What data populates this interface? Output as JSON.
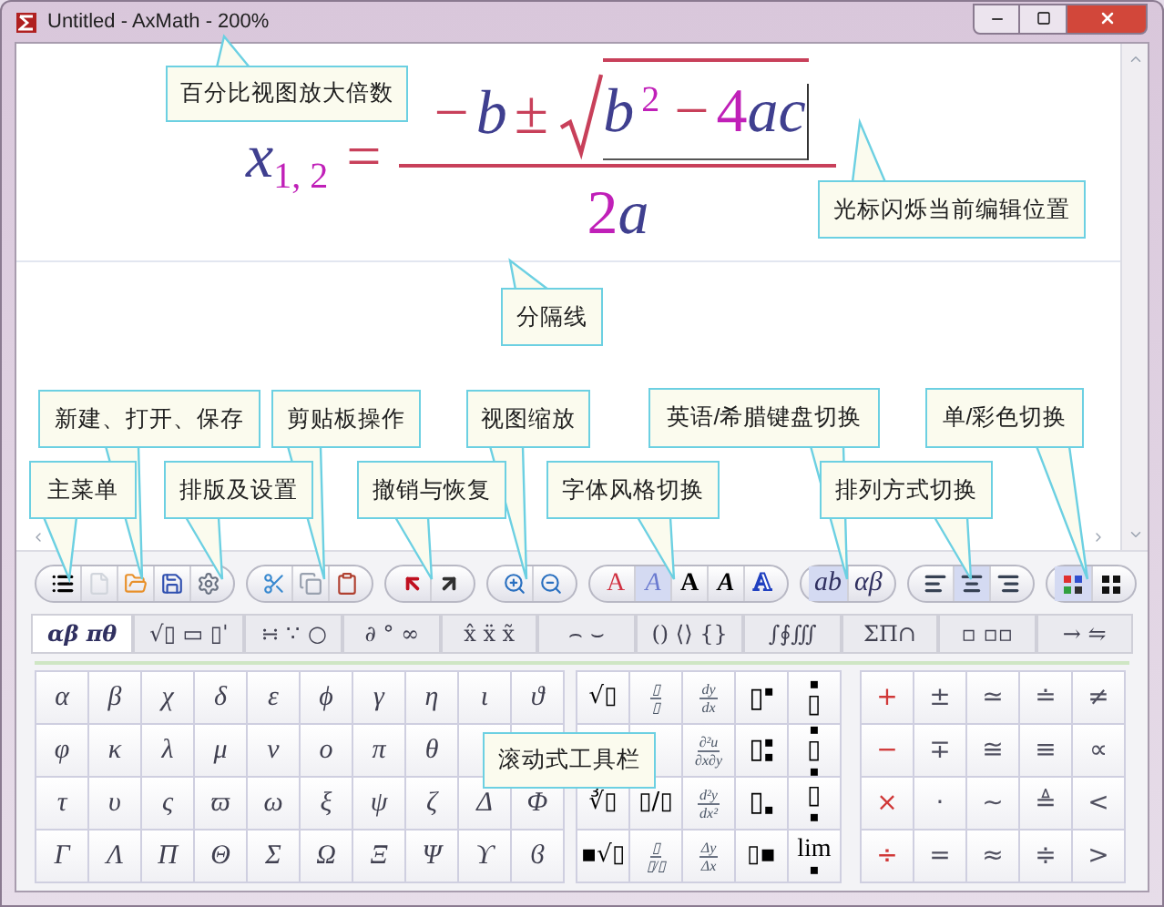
{
  "window": {
    "title": "Untitled - AxMath - 200%"
  },
  "formula": {
    "lhs": {
      "var": "x",
      "sub": "1, 2"
    },
    "eq": "=",
    "numerator": [
      {
        "text": "−",
        "kind": "op"
      },
      {
        "text": "b",
        "kind": "var"
      },
      {
        "text": "±",
        "kind": "op"
      }
    ],
    "radicand": [
      {
        "text": "b",
        "kind": "var"
      },
      {
        "text": "2",
        "kind": "sup"
      },
      {
        "text": "−",
        "kind": "op"
      },
      {
        "text": "4",
        "kind": "num"
      },
      {
        "text": "ac",
        "kind": "var"
      }
    ],
    "denominator": [
      {
        "text": "2",
        "kind": "num"
      },
      {
        "text": "a",
        "kind": "var"
      }
    ]
  },
  "callouts": [
    {
      "text": "百分比视图放大倍数"
    },
    {
      "text": "光标闪烁当前编辑位置"
    },
    {
      "text": "分隔线"
    },
    {
      "text": "新建、打开、保存"
    },
    {
      "text": "剪贴板操作"
    },
    {
      "text": "视图缩放"
    },
    {
      "text": "英语/希腊键盘切换"
    },
    {
      "text": "单/彩色切换"
    },
    {
      "text": "主菜单"
    },
    {
      "text": "排版及设置"
    },
    {
      "text": "撤销与恢复"
    },
    {
      "text": "字体风格切换"
    },
    {
      "text": "排列方式切换"
    },
    {
      "text": "滚动式工具栏"
    }
  ],
  "toolbar": [
    {
      "buttons": [
        {
          "kind": "menu"
        },
        {
          "kind": "new"
        },
        {
          "kind": "open"
        },
        {
          "kind": "save"
        },
        {
          "kind": "settings"
        }
      ]
    },
    {
      "buttons": [
        {
          "kind": "cut"
        },
        {
          "kind": "copy"
        },
        {
          "kind": "paste"
        }
      ]
    },
    {
      "buttons": [
        {
          "kind": "undo"
        },
        {
          "kind": "redo"
        }
      ]
    },
    {
      "buttons": [
        {
          "kind": "zoom-in"
        },
        {
          "kind": "zoom-out"
        }
      ]
    },
    {
      "buttons": [
        {
          "kind": "roman",
          "label": "A",
          "selected": false
        },
        {
          "kind": "italic",
          "label": "A",
          "selected": true
        },
        {
          "kind": "bold",
          "label": "A",
          "selected": false
        },
        {
          "kind": "bold-italic",
          "label": "A",
          "selected": false
        },
        {
          "kind": "outline",
          "label": "A",
          "selected": false
        }
      ]
    },
    {
      "buttons": [
        {
          "kind": "keyboard",
          "label": "ab",
          "selected": true
        },
        {
          "kind": "keyboard",
          "label": "αβ",
          "selected": false
        }
      ]
    },
    {
      "buttons": [
        {
          "kind": "align-left",
          "selected": false
        },
        {
          "kind": "align-center",
          "selected": true
        },
        {
          "kind": "align-right",
          "selected": false
        }
      ]
    },
    {
      "buttons": [
        {
          "kind": "color",
          "selected": true
        },
        {
          "kind": "mono",
          "selected": false
        }
      ]
    }
  ],
  "tabs": [
    {
      "label": "αβ πθ",
      "selected": true
    },
    {
      "label": "√▯ ▭ ▯ˈ",
      "selected": false
    },
    {
      "label": "∺ ∵ ○",
      "selected": false
    },
    {
      "label": "∂ ° ∞",
      "selected": false
    },
    {
      "label": "x̂ ẍ x̃",
      "selected": false
    },
    {
      "label": "⌢ ⌣",
      "selected": false
    },
    {
      "label": "() ⟨⟩ {}",
      "selected": false
    },
    {
      "label": "∫∮∭",
      "selected": false
    },
    {
      "label": "ΣΠ∩",
      "selected": false
    },
    {
      "label": "▫ ▫▫",
      "selected": false
    },
    {
      "label": "→ ⇋",
      "selected": false
    }
  ],
  "greek": [
    [
      "α",
      "β",
      "χ",
      "δ",
      "ε",
      "ϕ",
      "γ",
      "η",
      "ι",
      "ϑ"
    ],
    [
      "φ",
      "κ",
      "λ",
      "μ",
      "ν",
      "ο",
      "π",
      "θ"
    ],
    [
      "τ",
      "υ",
      "ς",
      "ϖ",
      "ω",
      "ξ",
      "ψ",
      "ζ",
      "Δ",
      "Φ"
    ],
    [
      "Γ",
      "Λ",
      "Π",
      "Θ",
      "Σ",
      "Ω",
      "Ξ",
      "Ψ",
      "ϒ",
      "ϐ"
    ]
  ],
  "templates": [
    [
      {
        "kind": "text",
        "text": "√▯"
      },
      {
        "kind": "frac",
        "num": "▯",
        "den": "▯"
      },
      {
        "kind": "frac",
        "num": "dy",
        "den": "dx"
      },
      {
        "kind": "sup",
        "text": "▯",
        "mark": "▪"
      },
      {
        "kind": "over",
        "text": "▯",
        "mark": "▪"
      }
    ],
    [
      {
        "kind": "none"
      },
      {
        "kind": "none"
      },
      {
        "kind": "frac",
        "num": "∂²u",
        "den": "∂x∂y"
      },
      {
        "kind": "supsub",
        "text": "▯",
        "mark": "▪"
      },
      {
        "kind": "overunder",
        "text": "▯",
        "mark": "▪"
      }
    ],
    [
      {
        "kind": "text",
        "text": "∛▯"
      },
      {
        "kind": "text",
        "text": "▯/▯"
      },
      {
        "kind": "frac",
        "num": "d²y",
        "den": "dx²"
      },
      {
        "kind": "sub",
        "text": "▯",
        "mark": "▪"
      },
      {
        "kind": "under",
        "text": "▯",
        "mark": "▪"
      }
    ],
    [
      {
        "kind": "text",
        "text": "▪√▯"
      },
      {
        "kind": "frac",
        "num": "▯",
        "den": "▯/▯"
      },
      {
        "kind": "frac",
        "num": "Δy",
        "den": "Δx"
      },
      {
        "kind": "text",
        "text": "▯▪"
      },
      {
        "kind": "under",
        "text": "lim",
        "mark": "▪"
      }
    ]
  ],
  "operators": [
    [
      {
        "text": "+",
        "kind": "arith"
      },
      {
        "text": "±",
        "kind": "rel"
      },
      {
        "text": "≃",
        "kind": "rel"
      },
      {
        "text": "≐",
        "kind": "rel"
      },
      {
        "text": "≠",
        "kind": "rel"
      }
    ],
    [
      {
        "text": "−",
        "kind": "arith"
      },
      {
        "text": "∓",
        "kind": "rel"
      },
      {
        "text": "≅",
        "kind": "rel"
      },
      {
        "text": "≡",
        "kind": "rel"
      },
      {
        "text": "∝",
        "kind": "rel"
      }
    ],
    [
      {
        "text": "×",
        "kind": "arith"
      },
      {
        "text": "·",
        "kind": "rel"
      },
      {
        "text": "~",
        "kind": "rel"
      },
      {
        "text": "≜",
        "kind": "rel"
      },
      {
        "text": "<",
        "kind": "rel"
      }
    ],
    [
      {
        "text": "÷",
        "kind": "arith"
      },
      {
        "text": "=",
        "kind": "rel"
      },
      {
        "text": "≈",
        "kind": "rel"
      },
      {
        "text": "≑",
        "kind": "rel"
      },
      {
        "text": ">",
        "kind": "rel"
      }
    ]
  ]
}
